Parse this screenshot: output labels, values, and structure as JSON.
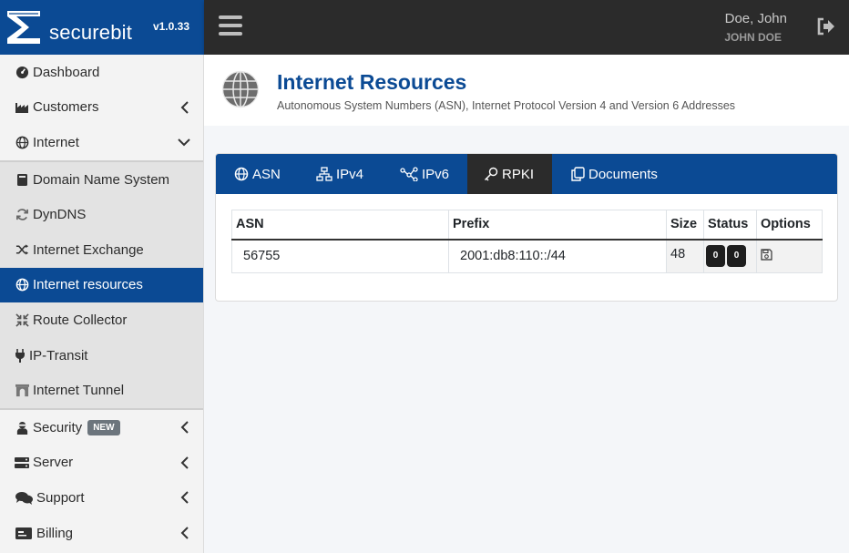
{
  "brand": {
    "name": "securebit",
    "version": "v1.0.33"
  },
  "user": {
    "name": "Doe, John",
    "username": "JOHN DOE"
  },
  "sidebar": {
    "items": [
      {
        "label": "Dashboard"
      },
      {
        "label": "Customers"
      },
      {
        "label": "Internet"
      },
      {
        "label": "Domain Name System"
      },
      {
        "label": "DynDNS"
      },
      {
        "label": "Internet Exchange"
      },
      {
        "label": "Internet resources"
      },
      {
        "label": "Route Collector"
      },
      {
        "label": "IP-Transit"
      },
      {
        "label": "Internet Tunnel"
      },
      {
        "label": "Security",
        "badge": "NEW"
      },
      {
        "label": "Server"
      },
      {
        "label": "Support"
      },
      {
        "label": "Billing"
      }
    ]
  },
  "page": {
    "title": "Internet Resources",
    "subtitle": "Autonomous System Numbers (ASN), Internet Protocol Version 4 and Version 6 Addresses"
  },
  "tabs": [
    {
      "label": "ASN"
    },
    {
      "label": "IPv4"
    },
    {
      "label": "IPv6"
    },
    {
      "label": "RPKI"
    },
    {
      "label": "Documents"
    }
  ],
  "table": {
    "headers": [
      "ASN",
      "Prefix",
      "Size",
      "Status",
      "Options"
    ],
    "rows": [
      {
        "asn": "56755",
        "prefix": "2001:db8:110::/44",
        "size": "48",
        "status": [
          "0",
          "0"
        ]
      }
    ]
  },
  "colors": {
    "primary": "#0b4a94",
    "dark": "#2b2b2b",
    "sidebar": "#f3f3f3"
  }
}
